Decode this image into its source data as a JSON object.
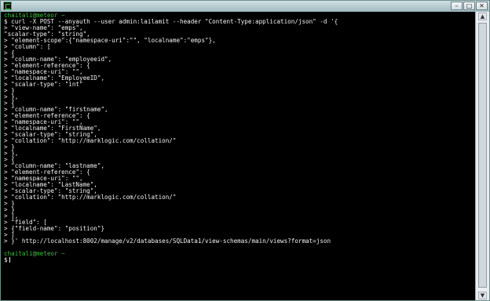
{
  "window": {
    "app_icon": "terminal-icon",
    "controls": {
      "minimize": "–",
      "maximize": "□",
      "close": "✕"
    }
  },
  "terminal": {
    "lines": [
      {
        "type": "prompt",
        "text": "chaitali@meteor ~"
      },
      {
        "type": "cmd",
        "text": "$ curl -X POST --anyauth --user admin:lailamit --header \"Content-Type:application/json\" -d '{"
      },
      {
        "type": "cmd",
        "text": "> \"view-name\": \"emps\","
      },
      {
        "type": "cmd",
        "text": "\"scalar-type\": \"string\","
      },
      {
        "type": "cmd",
        "text": "> \"element-scope\":{\"namespace-uri\":\"\", \"localname\":\"emps\"},"
      },
      {
        "type": "cmd",
        "text": "> \"column\": ["
      },
      {
        "type": "cmd",
        "text": "> {"
      },
      {
        "type": "cmd",
        "text": "> \"column-name\": \"employeeid\","
      },
      {
        "type": "cmd",
        "text": "> \"element-reference\": {"
      },
      {
        "type": "cmd",
        "text": "> \"namespace-uri\": \"\","
      },
      {
        "type": "cmd",
        "text": "> \"localname\": \"EmployeeID\","
      },
      {
        "type": "cmd",
        "text": "> \"scalar-type\": \"int\""
      },
      {
        "type": "cmd",
        "text": "> }"
      },
      {
        "type": "cmd",
        "text": "> },"
      },
      {
        "type": "cmd",
        "text": "> {"
      },
      {
        "type": "cmd",
        "text": "> \"column-name\": \"firstname\","
      },
      {
        "type": "cmd",
        "text": "> \"element-reference\": {"
      },
      {
        "type": "cmd",
        "text": "> \"namespace-uri\": \"\","
      },
      {
        "type": "cmd",
        "text": "> \"localname\": \"FirstName\","
      },
      {
        "type": "cmd",
        "text": "> \"scalar-type\": \"string\","
      },
      {
        "type": "cmd",
        "text": "> \"collation\": \"http://marklogic.com/collation/\""
      },
      {
        "type": "cmd",
        "text": "> }"
      },
      {
        "type": "cmd",
        "text": "> },"
      },
      {
        "type": "cmd",
        "text": "> {"
      },
      {
        "type": "cmd",
        "text": "> \"column-name\": \"lastname\","
      },
      {
        "type": "cmd",
        "text": "> \"element-reference\": {"
      },
      {
        "type": "cmd",
        "text": "> \"namespace-uri\": \"\","
      },
      {
        "type": "cmd",
        "text": "> \"localname\": \"LastName\","
      },
      {
        "type": "cmd",
        "text": "> \"scalar-type\": \"string\","
      },
      {
        "type": "cmd",
        "text": "> \"collation\": \"http://marklogic.com/collation/\""
      },
      {
        "type": "cmd",
        "text": "> }"
      },
      {
        "type": "cmd",
        "text": "> }"
      },
      {
        "type": "cmd",
        "text": "> ],"
      },
      {
        "type": "cmd",
        "text": "> \"field\": ["
      },
      {
        "type": "cmd",
        "text": "> {\"field-name\": \"position\"}"
      },
      {
        "type": "cmd",
        "text": "> ]"
      },
      {
        "type": "cmd",
        "text": "> }' http://localhost:8002/manage/v2/databases/SQLData1/view-schemas/main/views?format=json"
      },
      {
        "type": "blank",
        "text": ""
      },
      {
        "type": "prompt",
        "text": "chaitali@meteor ~"
      },
      {
        "type": "cmd",
        "text": "$"
      }
    ]
  }
}
